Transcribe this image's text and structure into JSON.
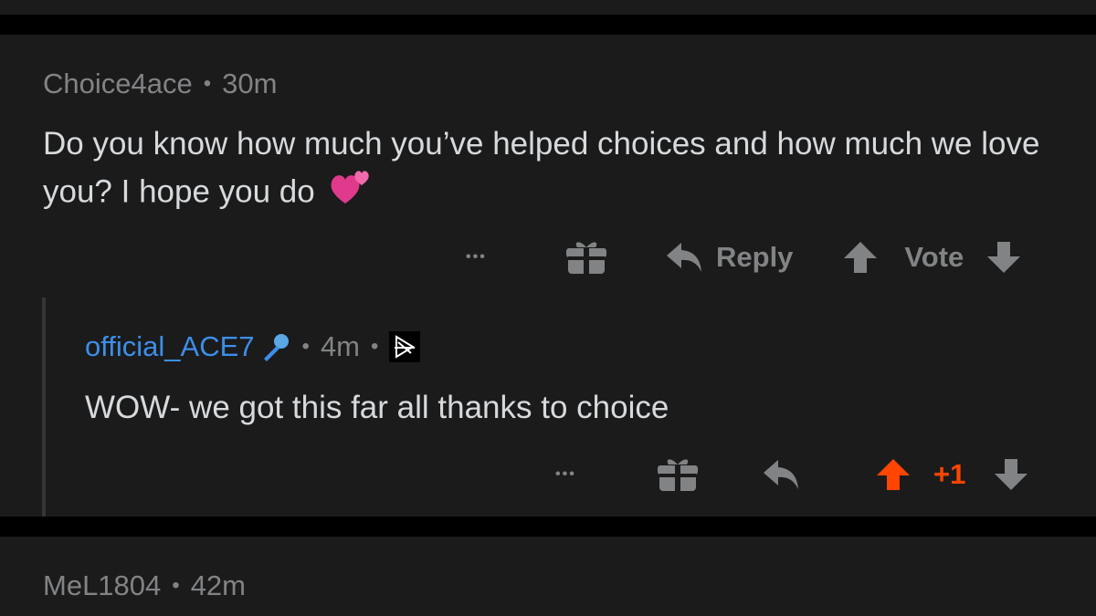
{
  "colors": {
    "background": "#1b1b1c",
    "separator": "#000000",
    "meta_text": "#818384",
    "body_text": "#d7dadc",
    "reply_username": "#3d8ee8",
    "upvote_active": "#ff4500"
  },
  "comments": [
    {
      "username": "Choice4ace",
      "separator": "•",
      "time": "30m",
      "body": "Do you know how much you’ve helped choices and how much we love you? I hope you do",
      "emoji": "two-hearts-emoji",
      "actions": {
        "more": "•••",
        "gift_icon": "gift-icon",
        "reply_label": "Reply",
        "vote_label": "Vote"
      }
    },
    {
      "username": "official_ACE7",
      "flair_icon": "microphone-icon",
      "separator": "•",
      "time": "4m",
      "badge_icon": "mod-badge-icon",
      "body": "WOW- we got this far all thanks to choice",
      "actions": {
        "more": "•••",
        "gift_icon": "gift-icon",
        "vote_count": "+1"
      }
    },
    {
      "username": "MeL1804",
      "separator": "•",
      "time": "42m"
    }
  ]
}
